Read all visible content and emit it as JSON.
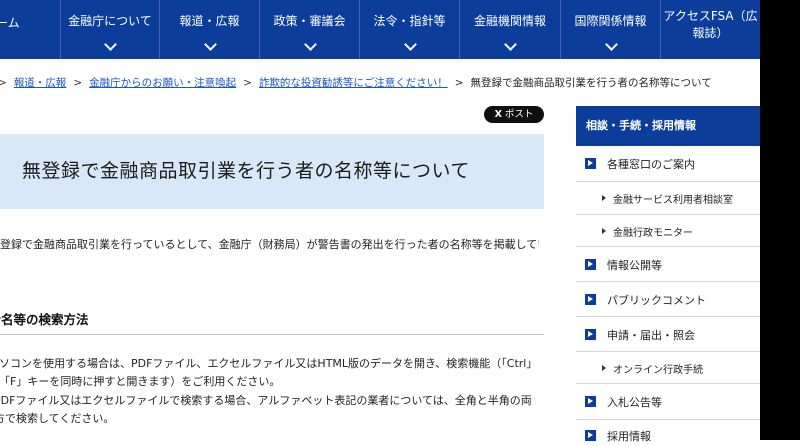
{
  "nav": {
    "items": [
      {
        "label": "ホーム"
      },
      {
        "label": "金融庁について"
      },
      {
        "label": "報道・広報"
      },
      {
        "label": "政策・審議会"
      },
      {
        "label": "法令・指針等"
      },
      {
        "label": "金融機関情報"
      },
      {
        "label": "国際関係情報"
      },
      {
        "label": "アクセスFSA（広報誌）"
      }
    ]
  },
  "breadcrumb": {
    "links": [
      "報道・広報",
      "金融庁からのお願い・注意喚起",
      "詐欺的な投資勧誘等にご注意ください！"
    ],
    "current": "無登録で金融商品取引業を行う者の名称等について",
    "separator": ">"
  },
  "share": {
    "post_label": "ポスト",
    "x_glyph": "X"
  },
  "page": {
    "title": "無登録で金融商品取引業を行う者の名称等について",
    "intro": "無登録で金融商品取引業を行っているとして、金融庁（財務局）が警告書の発出を行った者の名称等を掲載してい",
    "section_title": "業者名等の検索方法",
    "lines": [
      "パソコンを使用する場合は、PDFファイル、エクセルファイル又はHTML版のデータを開き、検索機能（「Ctrl」",
      "と「F」キーを同時に押すと開きます）をご利用ください。",
      "PDFファイル又はエクセルファイルで検索する場合、アルファベット表記の業者については、全角と半角の両",
      "方で検索してください。"
    ]
  },
  "sidebar": {
    "header": "相談・手続・採用情報",
    "items": [
      {
        "label": "各種窓口のご案内",
        "type": "main"
      },
      {
        "label": "金融サービス利用者相談室",
        "type": "sub"
      },
      {
        "label": "金融行政モニター",
        "type": "sub"
      },
      {
        "label": "情報公開等",
        "type": "main"
      },
      {
        "label": "パブリックコメント",
        "type": "main"
      },
      {
        "label": "申請・届出・照会",
        "type": "main"
      },
      {
        "label": "オンライン行政手続",
        "type": "sub"
      },
      {
        "label": "入札公告等",
        "type": "main"
      },
      {
        "label": "採用情報",
        "type": "main"
      }
    ]
  },
  "colors": {
    "brand": "#0d3d9a",
    "title_bg": "#d9e8f8",
    "link": "#1a55c8"
  }
}
